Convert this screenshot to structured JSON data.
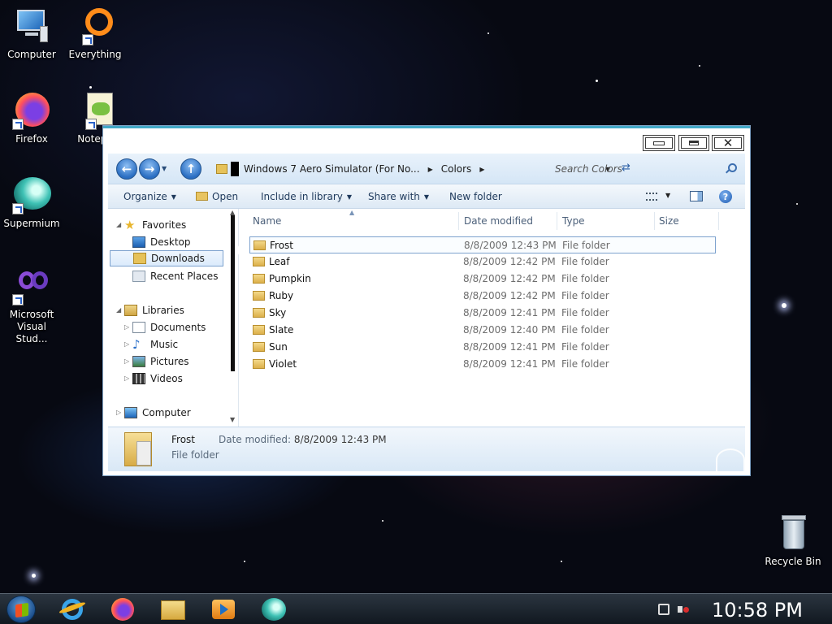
{
  "desktop": {
    "icons": [
      {
        "label": "Computer"
      },
      {
        "label": "Everything"
      },
      {
        "label": "Firefox"
      },
      {
        "label": "Notepa"
      },
      {
        "label": "Supermium"
      },
      {
        "label": "Microsoft Visual Stud..."
      },
      {
        "label": "Recycle Bin"
      }
    ]
  },
  "explorer": {
    "address": {
      "crumbs": [
        "Windows 7 Aero Simulator (For No...",
        "Colors"
      ]
    },
    "search": {
      "placeholder": "Search Colors"
    },
    "toolbar": {
      "organize": "Organize",
      "open": "Open",
      "include_in_library": "Include in library",
      "share_with": "Share with",
      "new_folder": "New folder"
    },
    "nav": {
      "favorites": "Favorites",
      "desktop": "Desktop",
      "downloads": "Downloads",
      "recent_places": "Recent Places",
      "libraries": "Libraries",
      "documents": "Documents",
      "music": "Music",
      "pictures": "Pictures",
      "videos": "Videos",
      "computer": "Computer"
    },
    "columns": {
      "name": "Name",
      "date_modified": "Date modified",
      "type": "Type",
      "size": "Size"
    },
    "files": [
      {
        "name": "Frost",
        "date": "8/8/2009 12:43 PM",
        "type": "File folder"
      },
      {
        "name": "Leaf",
        "date": "8/8/2009 12:42 PM",
        "type": "File folder"
      },
      {
        "name": "Pumpkin",
        "date": "8/8/2009 12:42 PM",
        "type": "File folder"
      },
      {
        "name": "Ruby",
        "date": "8/8/2009 12:42 PM",
        "type": "File folder"
      },
      {
        "name": "Sky",
        "date": "8/8/2009 12:41 PM",
        "type": "File folder"
      },
      {
        "name": "Slate",
        "date": "8/8/2009 12:40 PM",
        "type": "File folder"
      },
      {
        "name": "Sun",
        "date": "8/8/2009 12:41 PM",
        "type": "File folder"
      },
      {
        "name": "Violet",
        "date": "8/8/2009 12:41 PM",
        "type": "File folder"
      }
    ],
    "details": {
      "name": "Frost",
      "type": "File folder",
      "modified_label": "Date modified:",
      "modified_value": "8/8/2009 12:43 PM"
    }
  },
  "taskbar": {
    "clock": "10:58 PM"
  },
  "colors": {
    "title_accent": "#43a9c7",
    "selection_border": "#7da2ce",
    "nav_bar": "#d5e6f6"
  }
}
